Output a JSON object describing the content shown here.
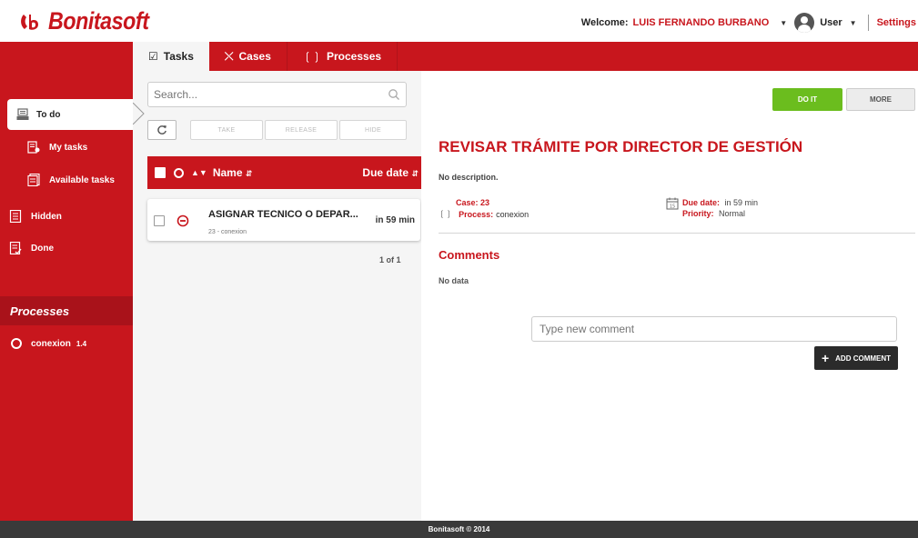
{
  "app": {
    "logo_text": "Bonitasoft",
    "brand_color": "#c8161d"
  },
  "header": {
    "welcome_label": "Welcome:",
    "user_name": "LUIS FERNANDO BURBANO",
    "user_label": "User",
    "settings_label": "Settings"
  },
  "nav": {
    "tabs": [
      {
        "label": "Tasks",
        "icon": "checkbox-icon",
        "active": true
      },
      {
        "label": "Cases",
        "icon": "shuffle-icon",
        "active": false
      },
      {
        "label": "Processes",
        "icon": "process-icon",
        "active": false
      }
    ]
  },
  "sidebar": {
    "items": [
      {
        "label": "To do",
        "icon": "inbox-tray-icon",
        "active": true
      },
      {
        "label": "My tasks",
        "icon": "my-tasks-icon"
      },
      {
        "label": "Available tasks",
        "icon": "available-tasks-icon"
      },
      {
        "label": "Hidden",
        "icon": "hidden-icon"
      },
      {
        "label": "Done",
        "icon": "done-icon"
      }
    ],
    "processes_header": "Processes",
    "processes": [
      {
        "name": "conexion",
        "version": "1.4"
      }
    ]
  },
  "list": {
    "search_placeholder": "Search...",
    "actions": [
      "TAKE",
      "RELEASE",
      "HIDE"
    ],
    "columns": {
      "name": "Name",
      "due_date": "Due date"
    },
    "rows": [
      {
        "name": "ASIGNAR TECNICO O DEPAR...",
        "subtitle": "23 - conexion",
        "due": "in 59 min"
      }
    ],
    "pager": "1 of 1"
  },
  "detail": {
    "do_it_label": "DO IT",
    "more_label": "MORE",
    "title": "REVISAR TRÁMITE POR DIRECTOR DE GESTIÓN",
    "description": "No description.",
    "case_label": "Case:",
    "case_value": "23",
    "process_label": "Process:",
    "process_value": "conexion",
    "due_label": "Due date:",
    "due_value": "in 59 min",
    "priority_label": "Priority:",
    "priority_value": "Normal",
    "comments_title": "Comments",
    "comments_empty": "No data",
    "comment_placeholder": "Type new comment",
    "add_comment_label": "ADD COMMENT",
    "colors": {
      "do_it": "#6bbd1e",
      "add_comment": "#2b2b2b"
    }
  },
  "footer": {
    "text": "Bonitasoft © 2014"
  }
}
